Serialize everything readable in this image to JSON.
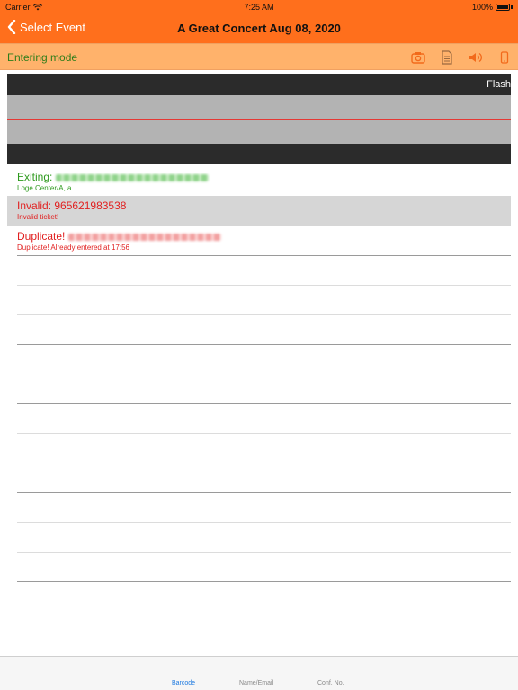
{
  "status_bar": {
    "carrier": "Carrier",
    "time": "7:25 AM",
    "battery": "100%"
  },
  "nav": {
    "back_label": "Select Event",
    "title": "A Great Concert Aug 08, 2020"
  },
  "mode": {
    "label": "Entering mode",
    "icons": [
      "camera-icon",
      "document-icon",
      "speaker-icon",
      "phone-icon"
    ]
  },
  "scanner": {
    "flash_label": "Flash"
  },
  "results": [
    {
      "status": "Exiting:",
      "detail": "Loge Center/A, a",
      "color": "green"
    },
    {
      "status": "Invalid: 965621983538",
      "detail": "Invalid ticket!",
      "color": "red"
    },
    {
      "status": "Duplicate!",
      "detail": "Duplicate! Already entered at 17:56",
      "color": "red"
    }
  ],
  "tabs": [
    {
      "label": "Barcode",
      "active": true
    },
    {
      "label": "Name/Email",
      "active": false
    },
    {
      "label": "Conf. No.",
      "active": false
    }
  ],
  "colors": {
    "accent": "#ff6f1c",
    "mode_bar": "#ffb26b",
    "success": "#2e9a1e",
    "error": "#e12020",
    "tab_active": "#1e7ae0"
  }
}
